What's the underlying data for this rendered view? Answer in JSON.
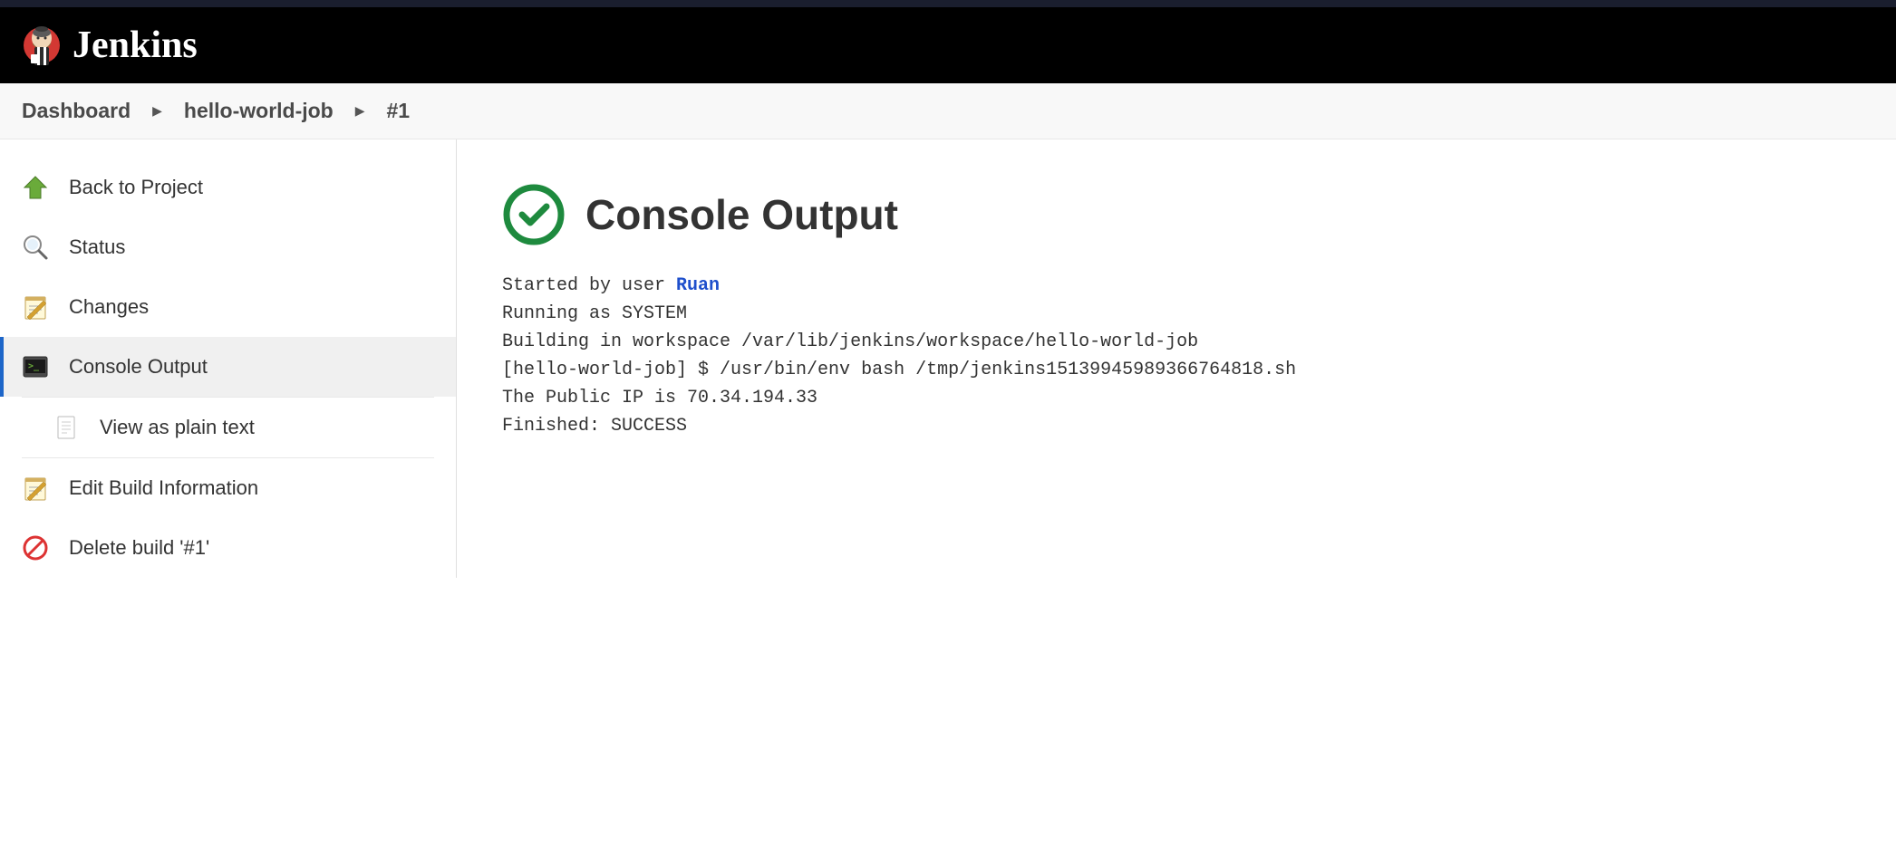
{
  "header": {
    "app_name": "Jenkins"
  },
  "breadcrumbs": {
    "items": [
      "Dashboard",
      "hello-world-job",
      "#1"
    ]
  },
  "sidebar": {
    "back_to_project": "Back to Project",
    "status": "Status",
    "changes": "Changes",
    "console_output": "Console Output",
    "view_as_plain_text": "View as plain text",
    "edit_build_information": "Edit Build Information",
    "delete_build": "Delete build '#1'"
  },
  "main": {
    "title": "Console Output",
    "started_by_prefix": "Started by user ",
    "started_by_user": "Ruan",
    "lines": [
      "Running as SYSTEM",
      "Building in workspace /var/lib/jenkins/workspace/hello-world-job",
      "[hello-world-job] $ /usr/bin/env bash /tmp/jenkins15139945989366764818.sh",
      "The Public IP is 70.34.194.33",
      "Finished: SUCCESS"
    ]
  }
}
